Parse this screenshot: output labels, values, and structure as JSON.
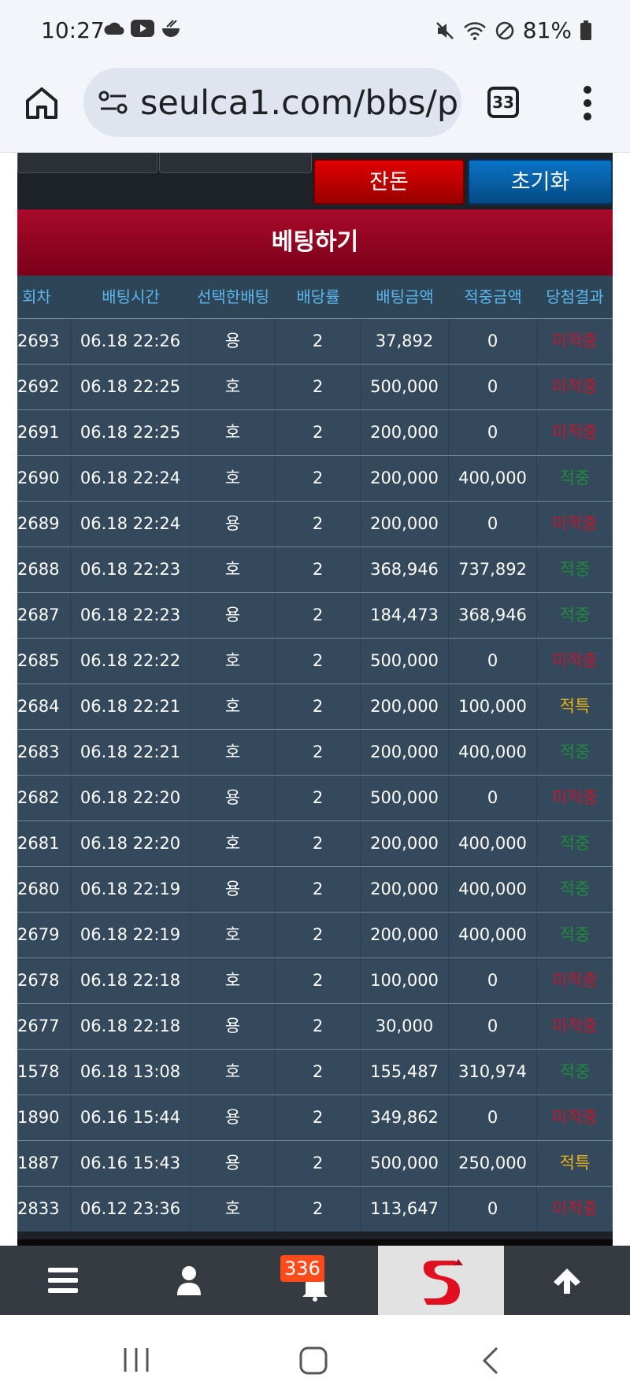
{
  "status_bar": {
    "time": "10:27",
    "battery": "81%"
  },
  "browser": {
    "url": "seulca1.com/bbs/p",
    "tab_count": "33"
  },
  "buttons": {
    "balance": "잔돈",
    "reset": "초기화"
  },
  "section_title": "베팅하기",
  "table": {
    "headers": [
      "회차",
      "배팅시간",
      "선택한배팅",
      "배당률",
      "배팅금액",
      "적중금액",
      "당첨결과"
    ],
    "rows": [
      {
        "round": "2693",
        "time": "06.18 22:26",
        "pick": "용",
        "odds": "2",
        "bet": "37,892",
        "win": "0",
        "result": "미적중",
        "type": "lose"
      },
      {
        "round": "2692",
        "time": "06.18 22:25",
        "pick": "호",
        "odds": "2",
        "bet": "500,000",
        "win": "0",
        "result": "미적중",
        "type": "lose"
      },
      {
        "round": "2691",
        "time": "06.18 22:25",
        "pick": "호",
        "odds": "2",
        "bet": "200,000",
        "win": "0",
        "result": "미적중",
        "type": "lose"
      },
      {
        "round": "2690",
        "time": "06.18 22:24",
        "pick": "호",
        "odds": "2",
        "bet": "200,000",
        "win": "400,000",
        "result": "적중",
        "type": "win"
      },
      {
        "round": "2689",
        "time": "06.18 22:24",
        "pick": "용",
        "odds": "2",
        "bet": "200,000",
        "win": "0",
        "result": "미적중",
        "type": "lose"
      },
      {
        "round": "2688",
        "time": "06.18 22:23",
        "pick": "호",
        "odds": "2",
        "bet": "368,946",
        "win": "737,892",
        "result": "적중",
        "type": "win"
      },
      {
        "round": "2687",
        "time": "06.18 22:23",
        "pick": "용",
        "odds": "2",
        "bet": "184,473",
        "win": "368,946",
        "result": "적중",
        "type": "win"
      },
      {
        "round": "2685",
        "time": "06.18 22:22",
        "pick": "호",
        "odds": "2",
        "bet": "500,000",
        "win": "0",
        "result": "미적중",
        "type": "lose"
      },
      {
        "round": "2684",
        "time": "06.18 22:21",
        "pick": "호",
        "odds": "2",
        "bet": "200,000",
        "win": "100,000",
        "result": "적특",
        "type": "refund"
      },
      {
        "round": "2683",
        "time": "06.18 22:21",
        "pick": "호",
        "odds": "2",
        "bet": "200,000",
        "win": "400,000",
        "result": "적중",
        "type": "win"
      },
      {
        "round": "2682",
        "time": "06.18 22:20",
        "pick": "용",
        "odds": "2",
        "bet": "500,000",
        "win": "0",
        "result": "미적중",
        "type": "lose"
      },
      {
        "round": "2681",
        "time": "06.18 22:20",
        "pick": "호",
        "odds": "2",
        "bet": "200,000",
        "win": "400,000",
        "result": "적중",
        "type": "win"
      },
      {
        "round": "2680",
        "time": "06.18 22:19",
        "pick": "용",
        "odds": "2",
        "bet": "200,000",
        "win": "400,000",
        "result": "적중",
        "type": "win"
      },
      {
        "round": "2679",
        "time": "06.18 22:19",
        "pick": "호",
        "odds": "2",
        "bet": "200,000",
        "win": "400,000",
        "result": "적중",
        "type": "win"
      },
      {
        "round": "2678",
        "time": "06.18 22:18",
        "pick": "호",
        "odds": "2",
        "bet": "100,000",
        "win": "0",
        "result": "미적중",
        "type": "lose"
      },
      {
        "round": "2677",
        "time": "06.18 22:18",
        "pick": "용",
        "odds": "2",
        "bet": "30,000",
        "win": "0",
        "result": "미적중",
        "type": "lose"
      },
      {
        "round": "1578",
        "time": "06.18 13:08",
        "pick": "호",
        "odds": "2",
        "bet": "155,487",
        "win": "310,974",
        "result": "적중",
        "type": "win"
      },
      {
        "round": "1890",
        "time": "06.16 15:44",
        "pick": "용",
        "odds": "2",
        "bet": "349,862",
        "win": "0",
        "result": "미적중",
        "type": "lose"
      },
      {
        "round": "1887",
        "time": "06.16 15:43",
        "pick": "용",
        "odds": "2",
        "bet": "500,000",
        "win": "250,000",
        "result": "적특",
        "type": "refund"
      },
      {
        "round": "2833",
        "time": "06.12 23:36",
        "pick": "호",
        "odds": "2",
        "bet": "113,647",
        "win": "0",
        "result": "미적중",
        "type": "lose"
      }
    ]
  },
  "bottom_nav": {
    "notification_count": "336"
  },
  "icons": [
    "home-icon",
    "site-settings-icon",
    "more-icon",
    "menu-icon",
    "user-icon",
    "bell-icon",
    "site-logo-icon",
    "arrow-up-icon",
    "recent-apps-icon",
    "home-nav-icon",
    "back-icon"
  ],
  "colors": {
    "title_red": "#a80a2a",
    "row_bg": "#34495c",
    "header_text": "#5ab8ee",
    "lose": "#c4162c",
    "win": "#1f8b3a",
    "refund": "#e8b21a"
  }
}
